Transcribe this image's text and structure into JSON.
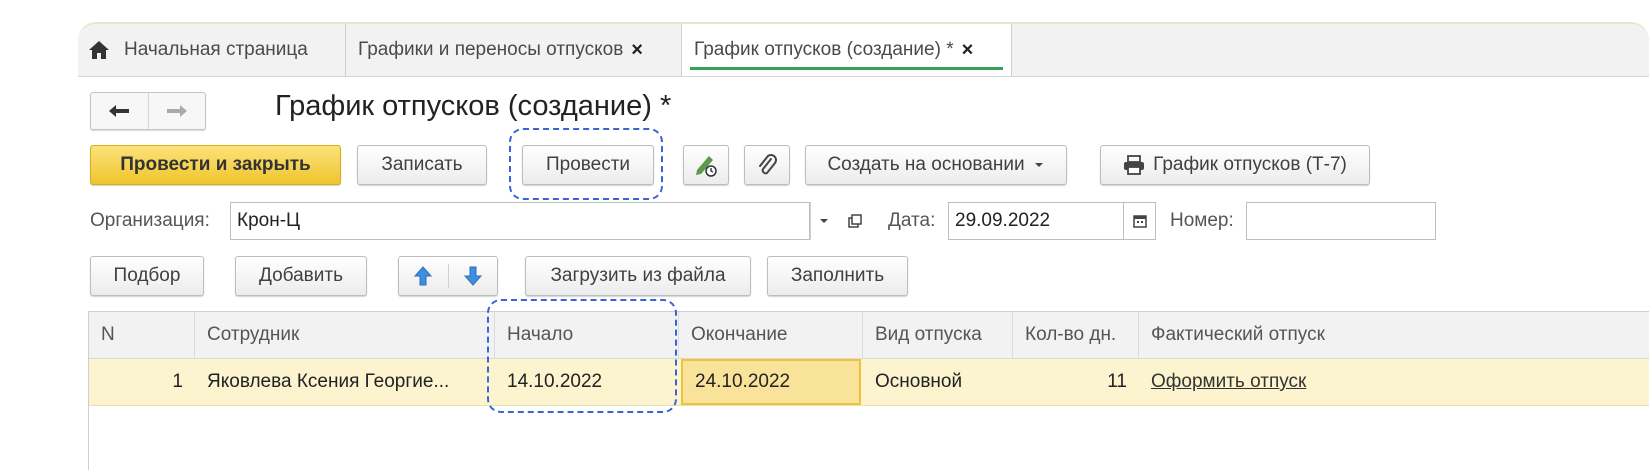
{
  "tabs": [
    {
      "label": "Начальная страница",
      "icon": "home-icon"
    },
    {
      "label": "Графики и переносы отпусков",
      "close": "×"
    },
    {
      "label": "График отпусков (создание) *",
      "close": "×",
      "active": true
    }
  ],
  "form": {
    "title": "График отпусков (создание) *"
  },
  "toolbar": {
    "post_and_close": "Провести и закрыть",
    "save": "Записать",
    "post": "Провести",
    "create_based_on": "Создать на основании",
    "print": "График отпусков (Т-7)"
  },
  "fields": {
    "organization_label": "Организация:",
    "organization_value": "Крон-Ц",
    "date_label": "Дата:",
    "date_value": "29.09.2022",
    "number_label": "Номер:",
    "number_value": ""
  },
  "table_toolbar": {
    "pick": "Подбор",
    "add": "Добавить",
    "load_from_file": "Загрузить из файла",
    "fill": "Заполнить"
  },
  "table": {
    "columns": [
      "N",
      "Сотрудник",
      "Начало",
      "Окончание",
      "Вид отпуска",
      "Кол-во дн.",
      "Фактический отпуск"
    ],
    "rows": [
      {
        "n": "1",
        "employee": "Яковлева Ксения Георгие...",
        "start": "14.10.2022",
        "end": "24.10.2022",
        "type": "Основной",
        "days": "11",
        "actual": "Оформить отпуск"
      }
    ]
  },
  "colors": {
    "primary_button": "#f0c52d",
    "highlight_dash": "#3a64d6",
    "row_selected": "#fcf4cf",
    "active_tab_underline": "#3aa15a"
  }
}
